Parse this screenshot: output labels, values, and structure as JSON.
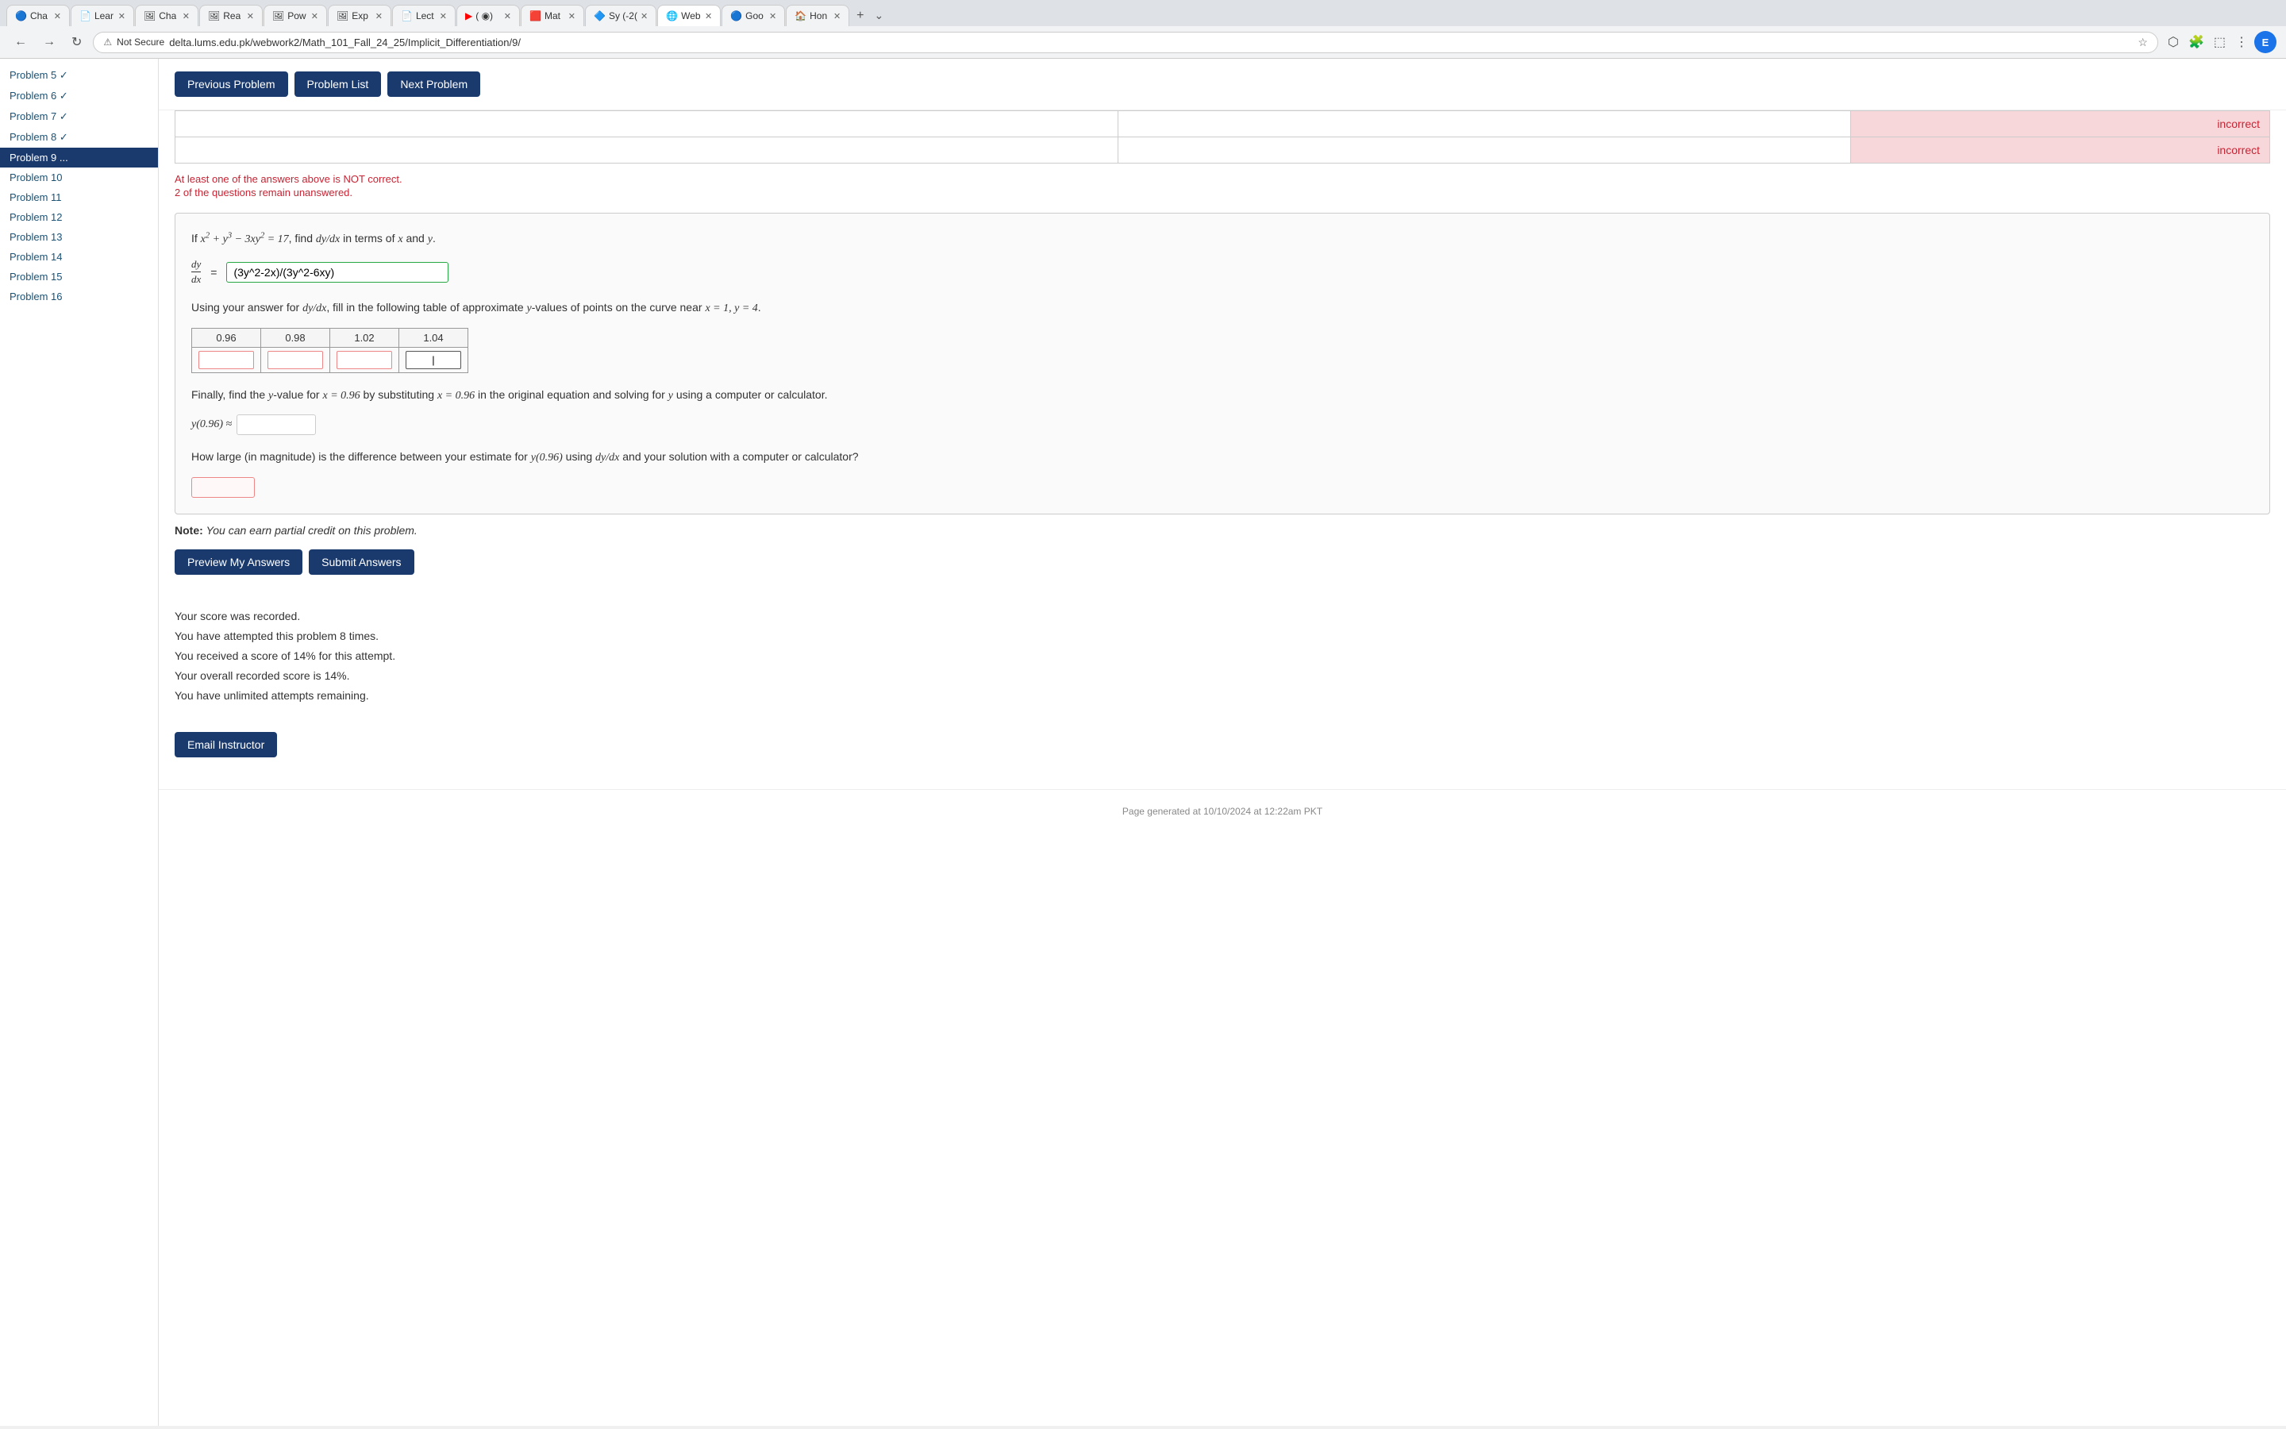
{
  "browser": {
    "tabs": [
      {
        "id": "t1",
        "label": "Cha",
        "active": false,
        "icon": "🔵"
      },
      {
        "id": "t2",
        "label": "Lear",
        "active": false,
        "icon": "📄"
      },
      {
        "id": "t3",
        "label": "Cha",
        "active": false,
        "icon": "🖼"
      },
      {
        "id": "t4",
        "label": "Rea",
        "active": false,
        "icon": "🖼"
      },
      {
        "id": "t5",
        "label": "Pow",
        "active": false,
        "icon": "🖼"
      },
      {
        "id": "t6",
        "label": "Exp",
        "active": false,
        "icon": "🖼"
      },
      {
        "id": "t7",
        "label": "Lect",
        "active": false,
        "icon": "📄"
      },
      {
        "id": "t8",
        "label": "( ◉)",
        "active": false,
        "icon": "▶"
      },
      {
        "id": "t9",
        "label": "Mat",
        "active": false,
        "icon": "🟥"
      },
      {
        "id": "t10",
        "label": "Sy (-2(",
        "active": false,
        "icon": "🟦"
      },
      {
        "id": "t11",
        "label": "Web",
        "active": true,
        "icon": "🌐"
      },
      {
        "id": "t12",
        "label": "Goo",
        "active": false,
        "icon": "🔵"
      },
      {
        "id": "t13",
        "label": "Hon",
        "active": false,
        "icon": "🏠"
      }
    ],
    "url": "delta.lums.edu.pk/webwork2/Math_101_Fall_24_25/Implicit_Differentiation/9/",
    "security_label": "Not Secure"
  },
  "sidebar": {
    "items": [
      {
        "label": "Problem 5 ✓",
        "active": false
      },
      {
        "label": "Problem 6 ✓",
        "active": false
      },
      {
        "label": "Problem 7 ✓",
        "active": false
      },
      {
        "label": "Problem 8 ✓",
        "active": false
      },
      {
        "label": "Problem 9 ...",
        "active": true
      },
      {
        "label": "Problem 10",
        "active": false
      },
      {
        "label": "Problem 11",
        "active": false
      },
      {
        "label": "Problem 12",
        "active": false
      },
      {
        "label": "Problem 13",
        "active": false
      },
      {
        "label": "Problem 14",
        "active": false
      },
      {
        "label": "Problem 15",
        "active": false
      },
      {
        "label": "Problem 16",
        "active": false
      }
    ]
  },
  "buttons": {
    "previous_problem": "Previous Problem",
    "problem_list": "Problem List",
    "next_problem": "Next Problem",
    "preview": "Preview My Answers",
    "submit": "Submit Answers",
    "email": "Email Instructor"
  },
  "answer_table": {
    "rows": [
      {
        "input": "",
        "answer": "",
        "status": "incorrect"
      },
      {
        "input": "",
        "answer": "",
        "status": "incorrect"
      }
    ]
  },
  "error": {
    "line1": "At least one of the answers above is NOT correct.",
    "line2": "2 of the questions remain unanswered."
  },
  "problem": {
    "description": "If x² + y³ − 3xy² = 17, find dy/dx in terms of x and y.",
    "dy_dx_label": "dy/dx =",
    "dy_dx_value": "(3y^2-2x)/(3y^2-6xy)",
    "table_intro": "Using your answer for dy/dx, fill in the following table of approximate y-values of points on the curve near x = 1, y = 4.",
    "x_values": [
      "0.96",
      "0.98",
      "1.02",
      "1.04"
    ],
    "y_inputs": [
      "",
      "",
      "",
      ""
    ],
    "finally_text": "Finally, find the y-value for x = 0.96 by substituting x = 0.96 in the original equation and solving for y using a computer or calculator.",
    "approx_label": "y(0.96) ≈",
    "approx_value": "",
    "diff_question": "How large (in magnitude) is the difference between your estimate for y(0.96) using dy/dx and your solution with a computer or calculator?",
    "diff_value": ""
  },
  "note": {
    "text": "You can earn partial credit on this problem."
  },
  "score": {
    "line1": "Your score was recorded.",
    "line2": "You have attempted this problem 8 times.",
    "line3": "You received a score of 14% for this attempt.",
    "line4": "Your overall recorded score is 14%.",
    "line5": "You have unlimited attempts remaining."
  },
  "footer": {
    "text": "Page generated at 10/10/2024 at 12:22am PKT"
  }
}
